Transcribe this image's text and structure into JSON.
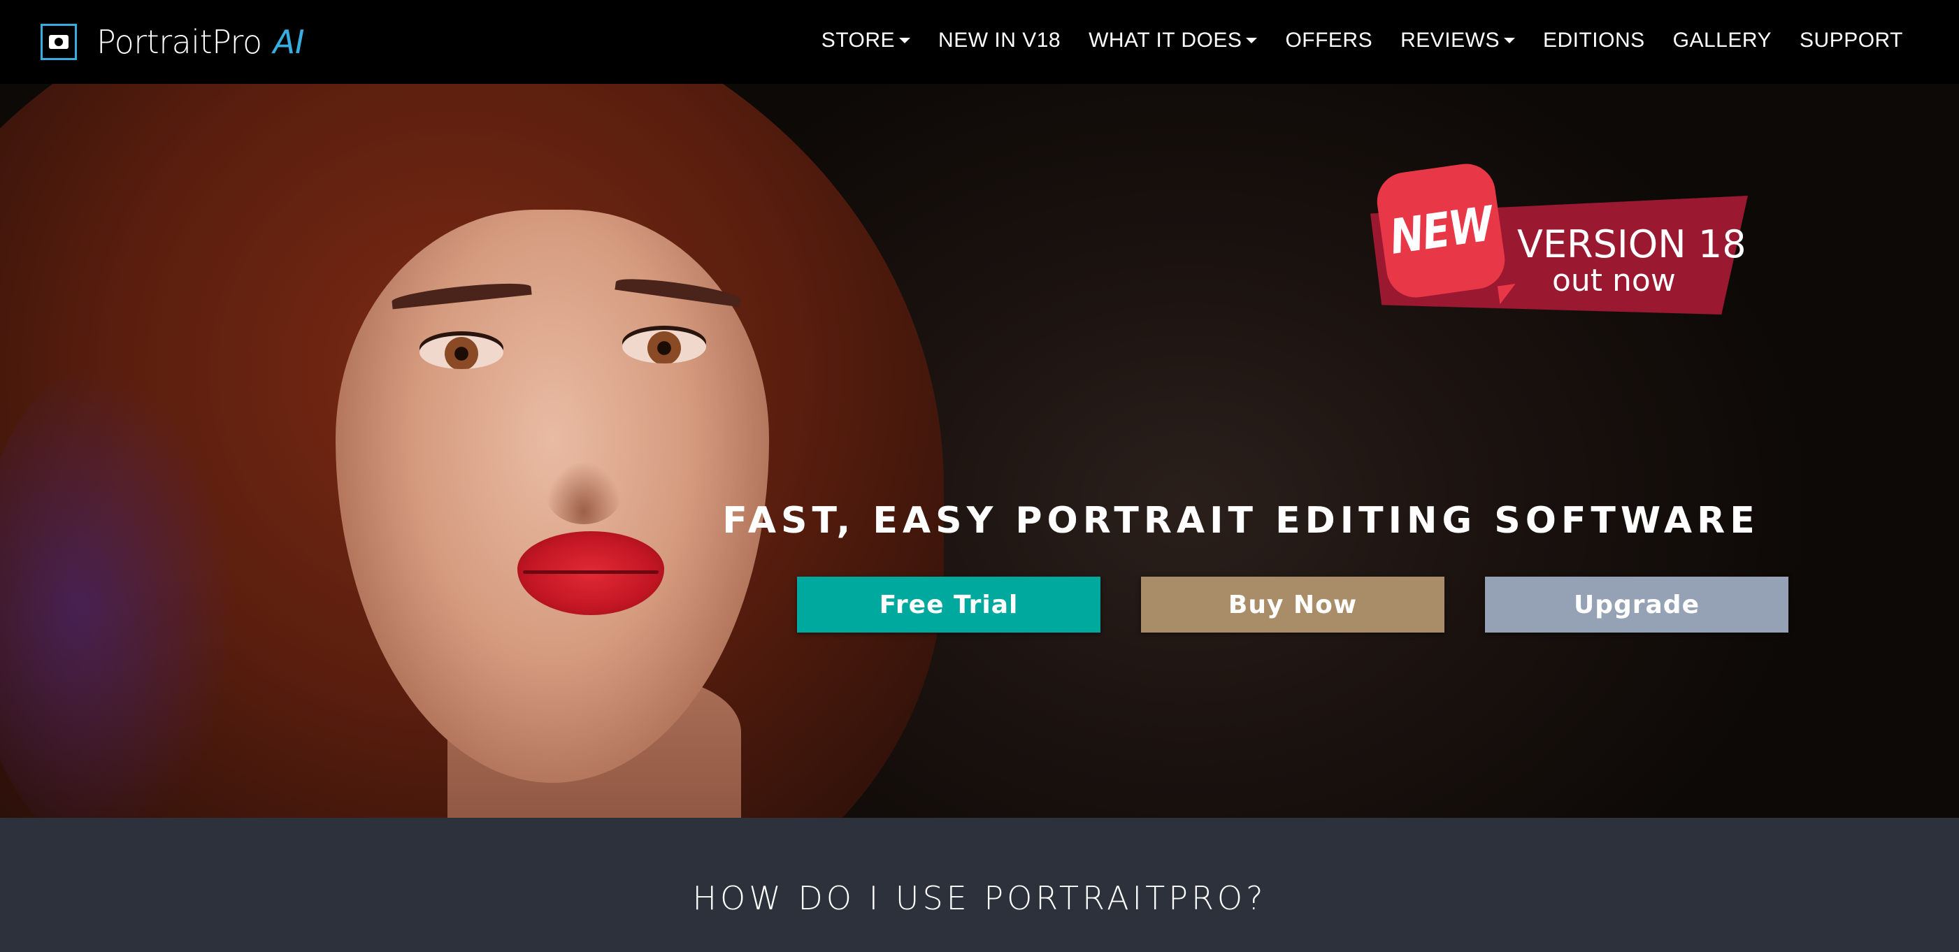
{
  "brand": {
    "logo_text": "PortraitPro",
    "logo_ai": "AI"
  },
  "nav": {
    "items": [
      {
        "label": "STORE",
        "dropdown": true
      },
      {
        "label": "NEW IN V18",
        "dropdown": false
      },
      {
        "label": "WHAT IT DOES",
        "dropdown": true
      },
      {
        "label": "OFFERS",
        "dropdown": false
      },
      {
        "label": "REVIEWS",
        "dropdown": true
      },
      {
        "label": "EDITIONS",
        "dropdown": false
      },
      {
        "label": "GALLERY",
        "dropdown": false
      },
      {
        "label": "SUPPORT",
        "dropdown": false
      }
    ]
  },
  "hero": {
    "badge_new": "NEW",
    "badge_version": "VERSION 18",
    "badge_out": "out now",
    "tagline": "FAST, EASY PORTRAIT EDITING SOFTWARE",
    "buttons": {
      "free_trial": "Free Trial",
      "buy_now": "Buy Now",
      "upgrade": "Upgrade"
    }
  },
  "section": {
    "title": "HOW DO I USE PORTRAITPRO?"
  },
  "colors": {
    "accent_blue": "#38aee0",
    "trial_button": "#00a99d",
    "buy_button": "#a88d68",
    "upgrade_button": "#95a1b4",
    "badge_red": "#e83747",
    "badge_ribbon": "#9a1830",
    "section_bg": "#2c313b"
  }
}
